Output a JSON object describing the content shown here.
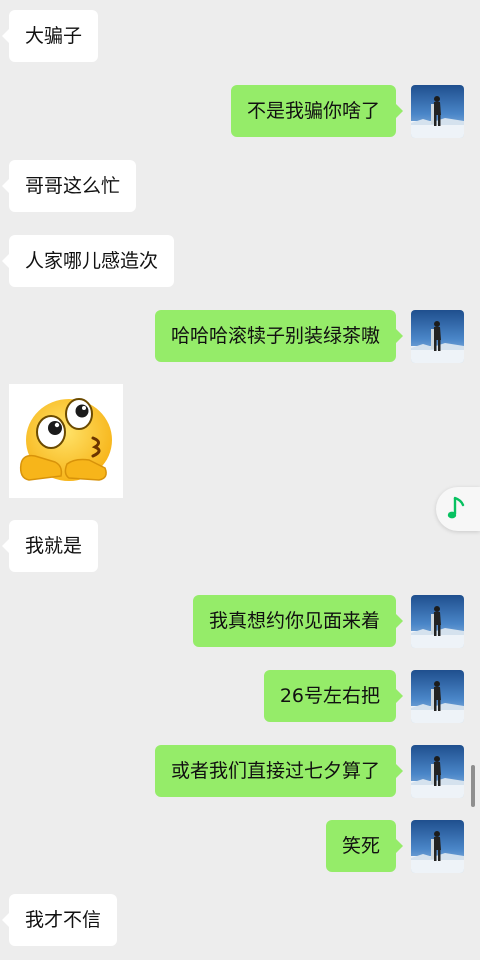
{
  "messages": [
    {
      "side": "left",
      "text": "大骗子"
    },
    {
      "side": "right",
      "text": "不是我骗你啥了"
    },
    {
      "side": "left",
      "text": "哥哥这么忙"
    },
    {
      "side": "left",
      "text": "人家哪儿感造次"
    },
    {
      "side": "right",
      "text": "哈哈哈滚犊子别装绿茶嗷"
    },
    {
      "side": "left",
      "type": "sticker",
      "icon": "kiss-emoji-icon"
    },
    {
      "side": "left",
      "text": "我就是"
    },
    {
      "side": "right",
      "text": "我真想约你见面来着"
    },
    {
      "side": "right",
      "text": "26号左右把"
    },
    {
      "side": "right",
      "text": "或者我们直接过七夕算了"
    },
    {
      "side": "right",
      "text": "笑死"
    },
    {
      "side": "left",
      "text": "我才不信"
    }
  ],
  "floating_button": {
    "icon": "music-note-icon",
    "color": "#07c160"
  },
  "colors": {
    "background": "#ededed",
    "incoming_bubble": "#ffffff",
    "outgoing_bubble": "#95ec69"
  }
}
